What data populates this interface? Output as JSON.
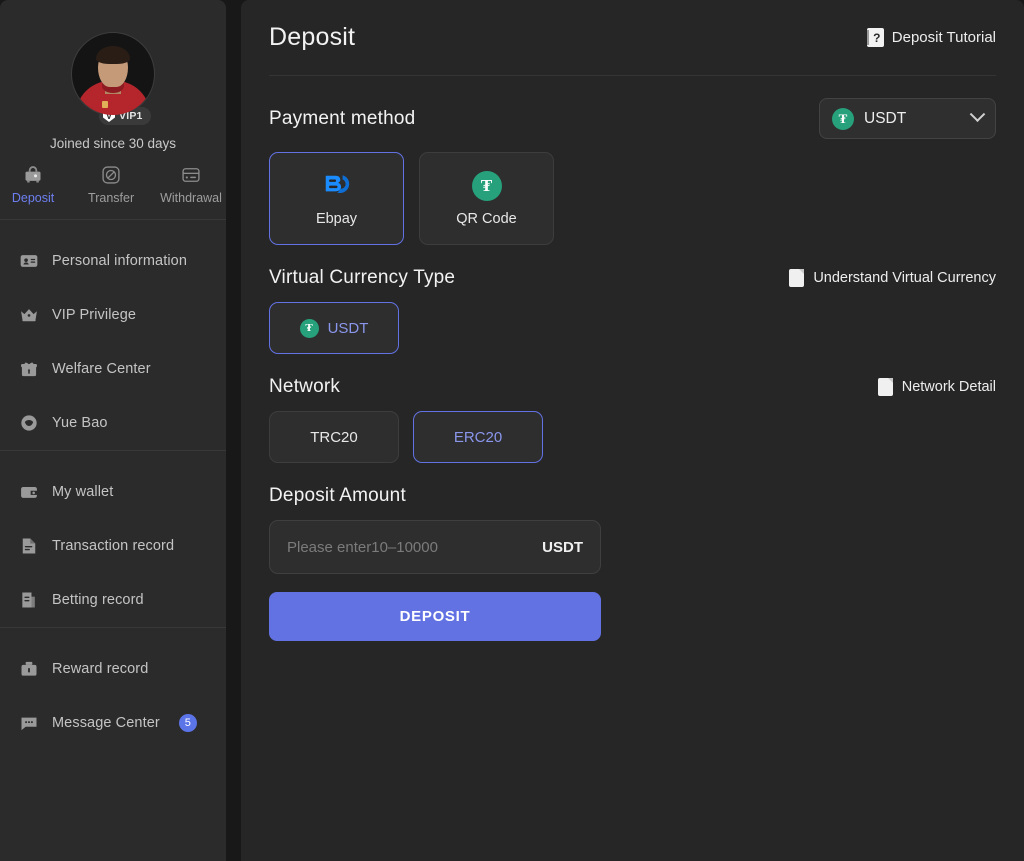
{
  "sidebar": {
    "profile": {
      "avatar_alt": "user-avatar",
      "vip_level": "VIP1",
      "vip_mark": "V",
      "joined": "Joined since 30 days"
    },
    "quick_actions": [
      {
        "label": "Deposit",
        "icon": "safe-icon",
        "active": true
      },
      {
        "label": "Transfer",
        "icon": "transfer-icon",
        "active": false
      },
      {
        "label": "Withdrawal",
        "icon": "card-icon",
        "active": false
      }
    ],
    "groups": [
      {
        "items": [
          {
            "label": "Personal information",
            "icon": "id-card-icon"
          },
          {
            "label": "VIP Privilege",
            "icon": "crown-icon"
          },
          {
            "label": "Welfare Center",
            "icon": "gift-icon"
          },
          {
            "label": "Yue Bao",
            "icon": "piggy-icon"
          }
        ]
      },
      {
        "items": [
          {
            "label": "My wallet",
            "icon": "wallet-icon"
          },
          {
            "label": "Transaction record",
            "icon": "document-icon"
          },
          {
            "label": "Betting record",
            "icon": "bet-document-icon"
          }
        ]
      },
      {
        "items": [
          {
            "label": "Reward record",
            "icon": "reward-wallet-icon"
          },
          {
            "label": "Message Center",
            "icon": "chat-icon",
            "badge": "5"
          }
        ]
      }
    ]
  },
  "main": {
    "title": "Deposit",
    "tutorial": {
      "label": "Deposit Tutorial",
      "icon": "question-book-icon"
    },
    "currency_select": {
      "value": "USDT",
      "icon": "usdt-icon",
      "chevron": "chevron-down-icon"
    },
    "payment_method": {
      "title": "Payment method",
      "options": [
        {
          "label": "Ebpay",
          "icon": "ebpay-icon",
          "selected": true
        },
        {
          "label": "QR Code",
          "icon": "usdt-icon",
          "selected": false
        }
      ]
    },
    "virtual_currency": {
      "title": "Virtual Currency Type",
      "link": {
        "label": "Understand Virtual Currency",
        "icon": "document-icon"
      },
      "options": [
        {
          "label": "USDT",
          "icon": "usdt-icon",
          "selected": true
        }
      ]
    },
    "network": {
      "title": "Network",
      "link": {
        "label": "Network Detail",
        "icon": "document-icon"
      },
      "options": [
        {
          "label": "TRC20",
          "selected": false
        },
        {
          "label": "ERC20",
          "selected": true
        }
      ]
    },
    "amount": {
      "title": "Deposit Amount",
      "placeholder": "Please enter10–10000",
      "value": "",
      "unit": "USDT",
      "submit_label": "DEPOSIT"
    }
  },
  "colors": {
    "accent": "#6272e3",
    "accent_text": "#8a96ec",
    "usdt_green": "#26a17b",
    "ebpay_blue": "#1a8cff",
    "sidebar_bg": "#2b2b2b",
    "main_bg": "#262626",
    "page_bg": "#181818",
    "badge_blue": "#5b74e8"
  }
}
